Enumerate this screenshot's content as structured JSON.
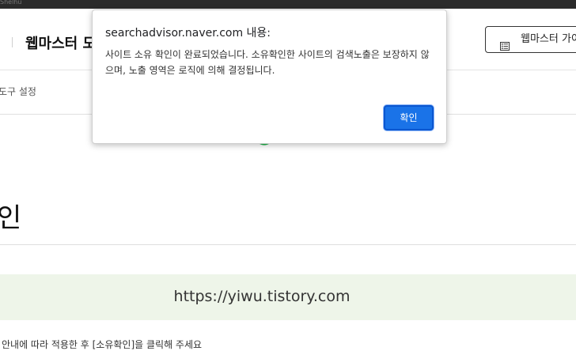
{
  "top_strip": {
    "text": "Shelhu"
  },
  "header": {
    "title": "웹마스터 도",
    "guide_button_label": "웹마스터 가이드",
    "guide_icon": "document-list-icon"
  },
  "subnav": {
    "item_label": "도구 설정"
  },
  "loading_icon": "loading-spinner-icon",
  "page": {
    "heading": "인",
    "url": "https://yiwu.tistory.com",
    "instruction": "안내에 따라 적용한 후 [소유확인]을 클릭해 주세요"
  },
  "dialog": {
    "title": "searchadvisor.naver.com 내용:",
    "message": "사이트 소유 확인이 완료되었습니다. 소유확인한 사이트의 검색노출은 보장하지 않으며, 노출 영역은 로직에 의해 결정됩니다.",
    "ok_label": "확인"
  },
  "colors": {
    "accent": "#1a73e8",
    "url_box_bg": "#eef5e9",
    "spinner": "#22b84c",
    "topbar": "#2b2b2b"
  }
}
